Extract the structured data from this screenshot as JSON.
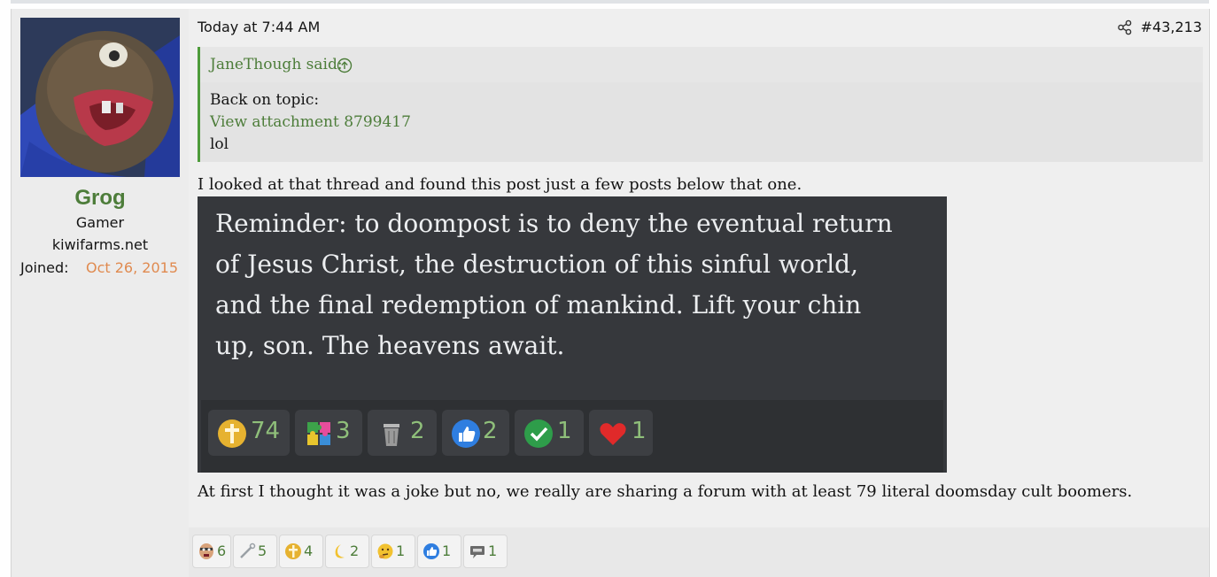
{
  "post": {
    "user": {
      "name": "Grog",
      "title": "Gamer",
      "banner": "kiwifarms.net",
      "joined_label": "Joined:",
      "joined_value": "Oct 26, 2015"
    },
    "timestamp": "Today at 7:44 AM",
    "post_number": "#43,213",
    "quote": {
      "author": "JaneThough said:",
      "lines": [
        "Back on topic:",
        "View attachment 8799417",
        "lol"
      ]
    },
    "body": {
      "line1": "I looked at that thread and found this post just a few posts below that one.",
      "line2": "At first I thought it was a joke but no, we really are sharing a forum with at least 79 literal doomsday cult boomers."
    },
    "embedded_image": {
      "lines": [
        "Reminder: to doompost is to deny the eventual return",
        "of Jesus Christ, the destruction of this sinful world,",
        "and the final redemption of mankind. Lift your chin",
        "up, son. The heavens await."
      ],
      "reactions": [
        {
          "icon": "gold-cross-icon",
          "count": "74"
        },
        {
          "icon": "autism-puzzle-icon",
          "count": "3"
        },
        {
          "icon": "trash-can-icon",
          "count": "2"
        },
        {
          "icon": "thumbs-up-icon",
          "count": "2"
        },
        {
          "icon": "check-mark-icon",
          "count": "1"
        },
        {
          "icon": "heart-icon",
          "count": "1"
        }
      ]
    },
    "reactions": [
      {
        "icon": "face-icon",
        "count": "6"
      },
      {
        "icon": "wrench-icon",
        "count": "5"
      },
      {
        "icon": "gold-cross-icon",
        "count": "4"
      },
      {
        "icon": "crescent-moon-icon",
        "count": "2"
      },
      {
        "icon": "thinking-face-icon",
        "count": "1"
      },
      {
        "icon": "thumbs-up-icon",
        "count": "1"
      },
      {
        "icon": "speech-bubble-icon",
        "count": "1"
      }
    ],
    "colors": {
      "username": "#4d7d3a",
      "link": "#4d7d3a",
      "joined_date": "#e08a4f",
      "quote_border": "#4d9b3a"
    }
  }
}
